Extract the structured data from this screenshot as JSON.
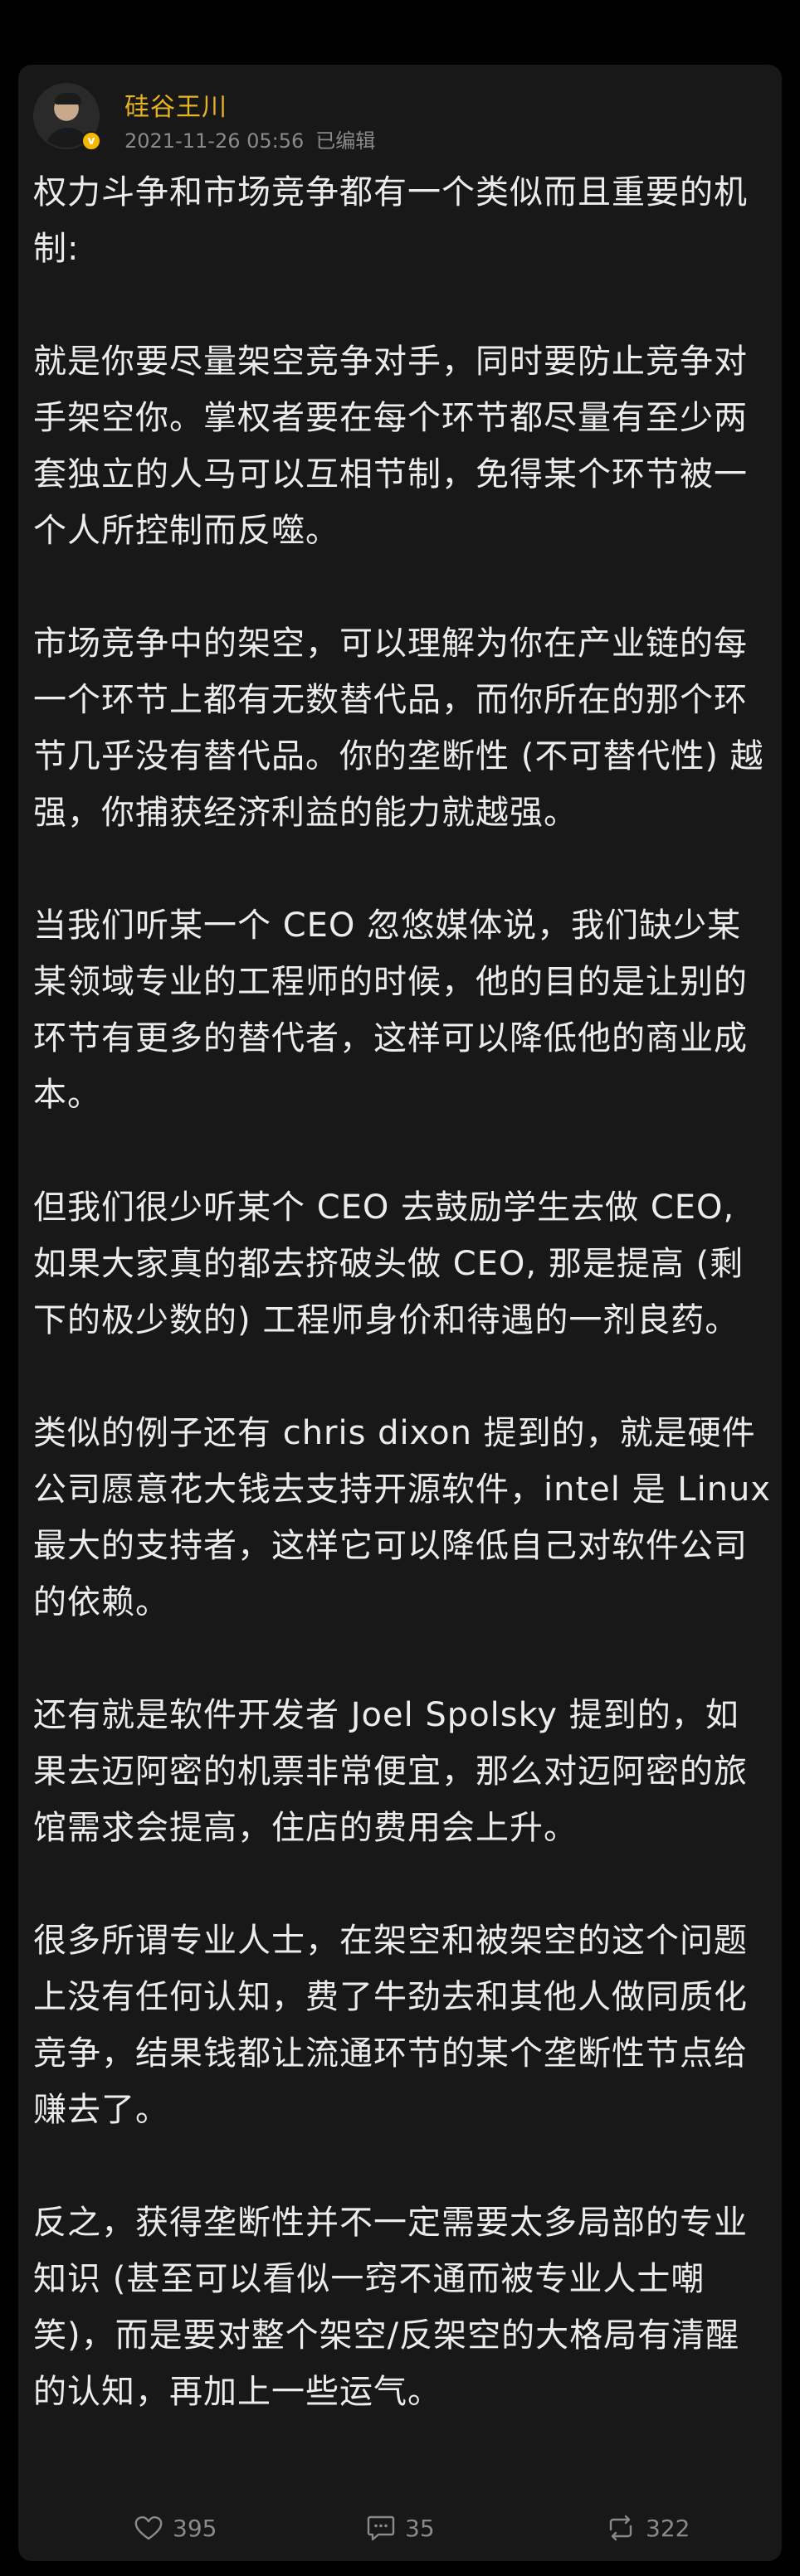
{
  "post": {
    "author": "硅谷王川",
    "badge": "v",
    "timestamp": "2021-11-26 05:56",
    "edited_label": "已编辑",
    "paragraphs": [
      "权力斗争和市场竞争都有一个类似而且重要的机制:",
      "就是你要尽量架空竞争对手，同时要防止竞争对手架空你。掌权者要在每个环节都尽量有至少两套独立的人马可以互相节制，免得某个环节被一个人所控制而反噬。",
      "市场竞争中的架空，可以理解为你在产业链的每一个环节上都有无数替代品，而你所在的那个环节几乎没有替代品。你的垄断性 (不可替代性) 越强，你捕获经济利益的能力就越强。",
      "当我们听某一个 CEO 忽悠媒体说，我们缺少某某领域专业的工程师的时候，他的目的是让别的环节有更多的替代者，这样可以降低他的商业成本。",
      "但我们很少听某个 CEO 去鼓励学生去做 CEO, 如果大家真的都去挤破头做 CEO, 那是提高 (剩下的极少数的) 工程师身价和待遇的一剂良药。",
      "类似的例子还有 chris dixon 提到的，就是硬件公司愿意花大钱去支持开源软件，intel 是 Linux 最大的支持者，这样它可以降低自己对软件公司的依赖。",
      "还有就是软件开发者 Joel Spolsky 提到的，如果去迈阿密的机票非常便宜，那么对迈阿密的旅馆需求会提高，住店的费用会上升。",
      "很多所谓专业人士，在架空和被架空的这个问题上没有任何认知，费了牛劲去和其他人做同质化竞争，结果钱都让流通环节的某个垄断性节点给赚去了。",
      "反之，获得垄断性并不一定需要太多局部的专业知识 (甚至可以看似一窍不通而被专业人士嘲笑)，而是要对整个架空/反架空的大格局有清醒的认知，再加上一些运气。"
    ],
    "actions": {
      "likes": "395",
      "comments": "35",
      "reposts": "322"
    }
  },
  "colors": {
    "background": "#000000",
    "card": "#181818",
    "author": "#e6b422",
    "text": "#ececec",
    "meta": "#8a8a8a",
    "badge": "#f5b700"
  },
  "icons": [
    "avatar",
    "verified-badge-icon",
    "heart-icon",
    "comment-icon",
    "repost-icon"
  ]
}
